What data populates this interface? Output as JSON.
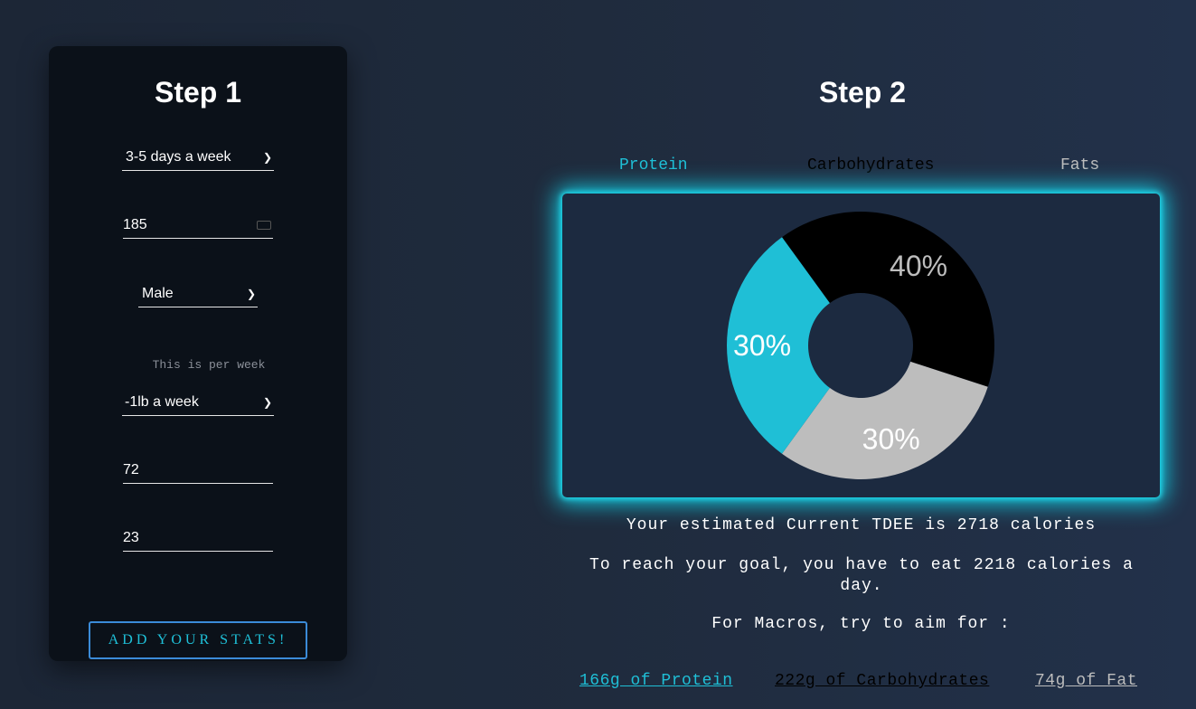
{
  "step1": {
    "title": "Step 1",
    "activity": "3-5 days a week",
    "weight": "185",
    "gender": "Male",
    "hint": "This is per week",
    "goal": "-1lb a week",
    "height": "72",
    "age": "23",
    "button": "ADD YOUR STATS!"
  },
  "step2": {
    "title": "Step 2",
    "tabs": [
      "Protein",
      "Carbohydrates",
      "Fats"
    ],
    "tdee_text": "Your estimated Current TDEE is 2718 calories",
    "goal_text": "To reach your goal, you have to eat 2218 calories a day.",
    "macro_intro": "For Macros, try to aim for :",
    "macros": [
      "166g of Protein",
      "222g of Carbohydrates",
      "74g of Fat"
    ]
  },
  "colors": {
    "protein": "#1fbfd6",
    "carbs": "#000000",
    "fats": "#bdbdbd",
    "accent": "#13d0e6"
  },
  "chart_data": {
    "type": "pie",
    "categories": [
      "Carbohydrates",
      "Fats",
      "Protein"
    ],
    "values": [
      40,
      30,
      30
    ],
    "labels": [
      "40%",
      "30%",
      "30%"
    ]
  }
}
